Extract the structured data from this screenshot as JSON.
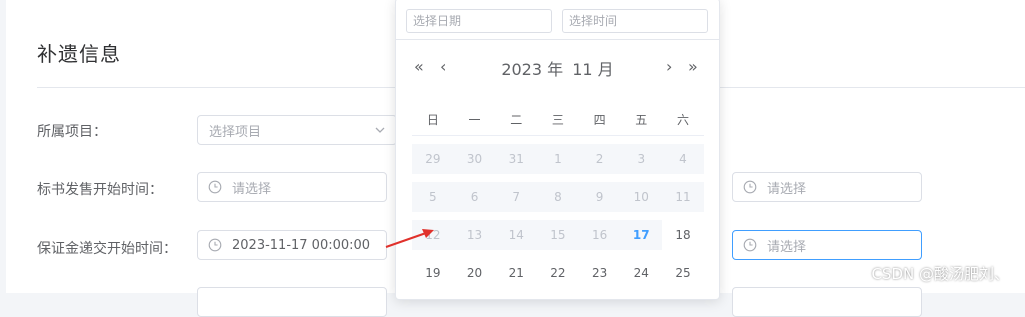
{
  "section": {
    "title": "补遗信息"
  },
  "form": {
    "project": {
      "label": "所属项目：",
      "placeholder": "选择项目"
    },
    "bid_sale_start": {
      "label": "标书发售开始时间：",
      "placeholder": "请选择",
      "right_placeholder": "请选择"
    },
    "deposit_start": {
      "label": "保证金递交开始时间：",
      "value": "2023-11-17 00:00:00",
      "right_placeholder": "请选择"
    }
  },
  "picker": {
    "date_placeholder": "选择日期",
    "time_placeholder": "选择时间",
    "year": "2023 年",
    "month": "11 月",
    "weekdays": [
      "日",
      "一",
      "二",
      "三",
      "四",
      "五",
      "六"
    ],
    "rows": [
      [
        "29",
        "30",
        "31",
        "1",
        "2",
        "3",
        "4"
      ],
      [
        "5",
        "6",
        "7",
        "8",
        "9",
        "10",
        "11"
      ],
      [
        "12",
        "13",
        "14",
        "15",
        "16",
        "17",
        "18"
      ],
      [
        "19",
        "20",
        "21",
        "22",
        "23",
        "24",
        "25"
      ]
    ],
    "today": "17"
  },
  "watermark": "CSDN @酸汤肥刘、",
  "colors": {
    "accent": "#409eff",
    "arrow": "#e0312b"
  }
}
